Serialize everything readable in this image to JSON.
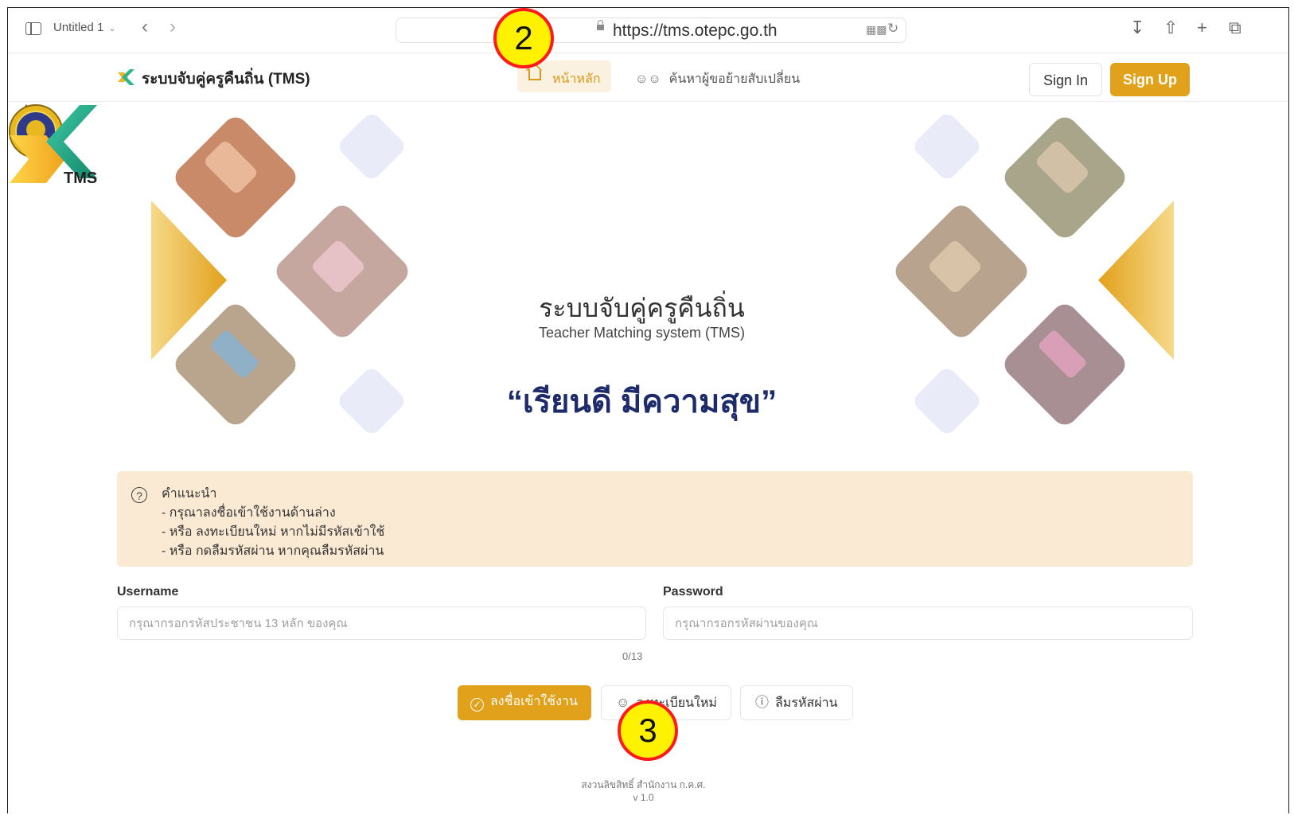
{
  "browser": {
    "tab_name": "Untitled 1",
    "url": "https://tms.otepc.go.th"
  },
  "header": {
    "brand": "ระบบจับคู่ครูคืนถิ่น (TMS)",
    "nav_home": "หน้าหลัก",
    "nav_search": "ค้นหาผู้ขอย้ายสับเปลี่ยน",
    "sign_in": "Sign In",
    "sign_up": "Sign Up"
  },
  "hero": {
    "logo_text": "TMS",
    "title_th": "ระบบจับคู่ครูคืนถิ่น",
    "title_en": "Teacher Matching system (TMS)",
    "slogan": "“เรียนดี มีความสุข”"
  },
  "notice": {
    "title": "คำแนะนำ",
    "lines": [
      "- กรุณาลงชื่อเข้าใช้งานด้านล่าง",
      "- หรือ ลงทะเบียนใหม่ หากไม่มีรหัสเข้าใช้",
      "- หรือ กดลืมรหัสผ่าน หากคุณลืมรหัสผ่าน"
    ]
  },
  "form": {
    "username_label": "Username",
    "username_placeholder": "กรุณากรอกรหัสประชาชน 13 หลัก ของคุณ",
    "username_counter": "0/13",
    "password_label": "Password",
    "password_placeholder": "กรุณากรอกรหัสผ่านของคุณ"
  },
  "buttons": {
    "login": "ลงชื่อเข้าใช้งาน",
    "register": "ลงทะเบียนใหม่",
    "forgot": "ลืมรหัสผ่าน"
  },
  "footer": {
    "copyright": "สงวนลิขสิทธิ์ สำนักงาน ก.ค.ศ.",
    "version": "v 1.0"
  },
  "annotations": {
    "badge_top": "2",
    "badge_bottom": "3"
  },
  "colors": {
    "accent": "#e2a11b",
    "notice_bg": "#fbead3",
    "slogan": "#1d2b6b",
    "badge_fill": "#fff200",
    "badge_border": "#ff1a1a"
  }
}
